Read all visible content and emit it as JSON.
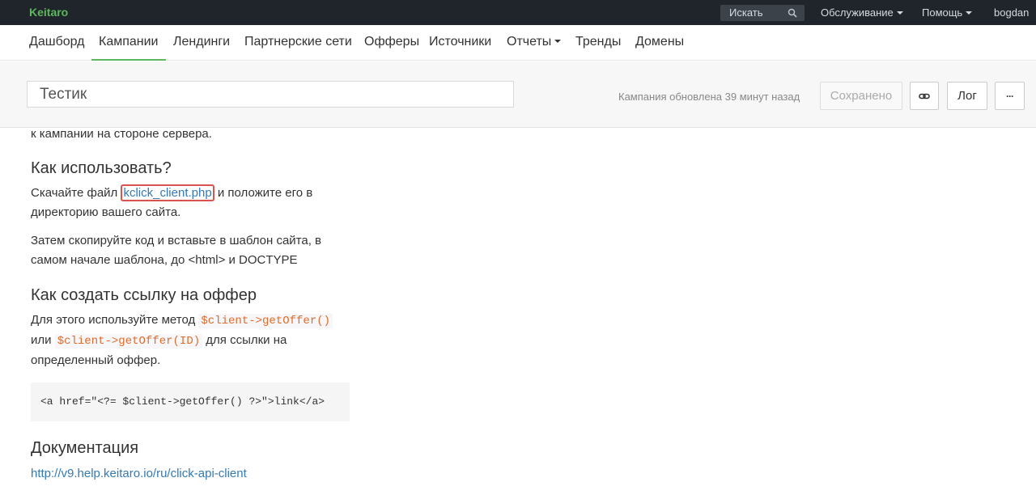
{
  "topbar": {
    "brand": "Keitaro",
    "search_placeholder": "Искать",
    "menu": {
      "service": "Обслуживание",
      "help": "Помощь",
      "user": "bogdan"
    }
  },
  "nav": {
    "items": [
      "Дашборд",
      "Кампании",
      "Лендинги",
      "Партнерские сети",
      "Офферы",
      "Источники",
      "Отчеты",
      "Тренды",
      "Домены"
    ],
    "active": "Кампании"
  },
  "campaign": {
    "name_value": "Тестик",
    "updated_text": "Кампания обновлена 39 минут назад",
    "buttons": {
      "saved": "Сохранено",
      "log": "Лог",
      "more": "···"
    }
  },
  "content": {
    "intro_tail": "к кампании на стороне сервера.",
    "how_heading": "Как использовать?",
    "download_pre": "Скачайте файл ",
    "download_link": "kclick_client.php",
    "download_post_line1": " и положите его в",
    "download_post_line2": "директорию вашего сайта.",
    "copy_line1": "Затем скопируйте код и вставьте в шаблон сайта, в",
    "copy_line2": "самом начале шаблона, до <html> и DOCTYPE",
    "offer_heading": "Как создать ссылку на оффер",
    "offer_pre": "Для этого используйте метод ",
    "offer_code1": "$client->getOffer()",
    "offer_or": "или ",
    "offer_code2": "$client->getOffer(ID)",
    "offer_post": " для ссылки на",
    "offer_line3": "определенный оффер.",
    "code_block": "<a href=\"<?= $client->getOffer() ?>\">link</a>",
    "docs_heading": "Документация",
    "docs_link": "http://v9.help.keitaro.io/ru/click-api-client"
  }
}
